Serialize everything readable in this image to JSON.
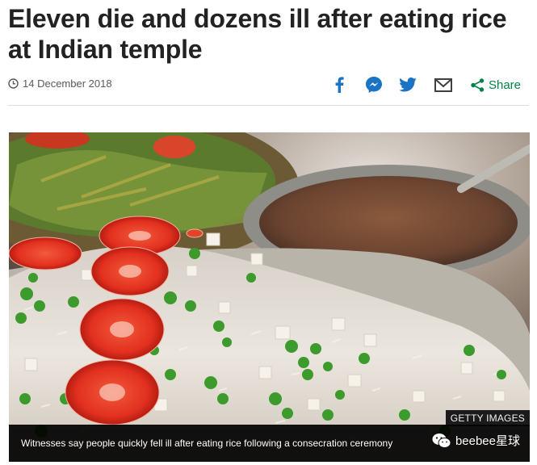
{
  "article": {
    "headline": "Eleven die and dozens ill after eating rice at Indian temple",
    "date": "14 December 2018"
  },
  "share": {
    "label": "Share",
    "icons": [
      "facebook-icon",
      "messenger-icon",
      "twitter-icon",
      "email-icon",
      "share-icon"
    ],
    "brand_color": "#008347",
    "icon_color": "#1b73c4"
  },
  "image": {
    "credit": "GETTY IMAGES",
    "caption": "Witnesses say people quickly fell ill after eating rice following a consecration ceremony"
  },
  "watermark": {
    "text": "beebee星球"
  }
}
